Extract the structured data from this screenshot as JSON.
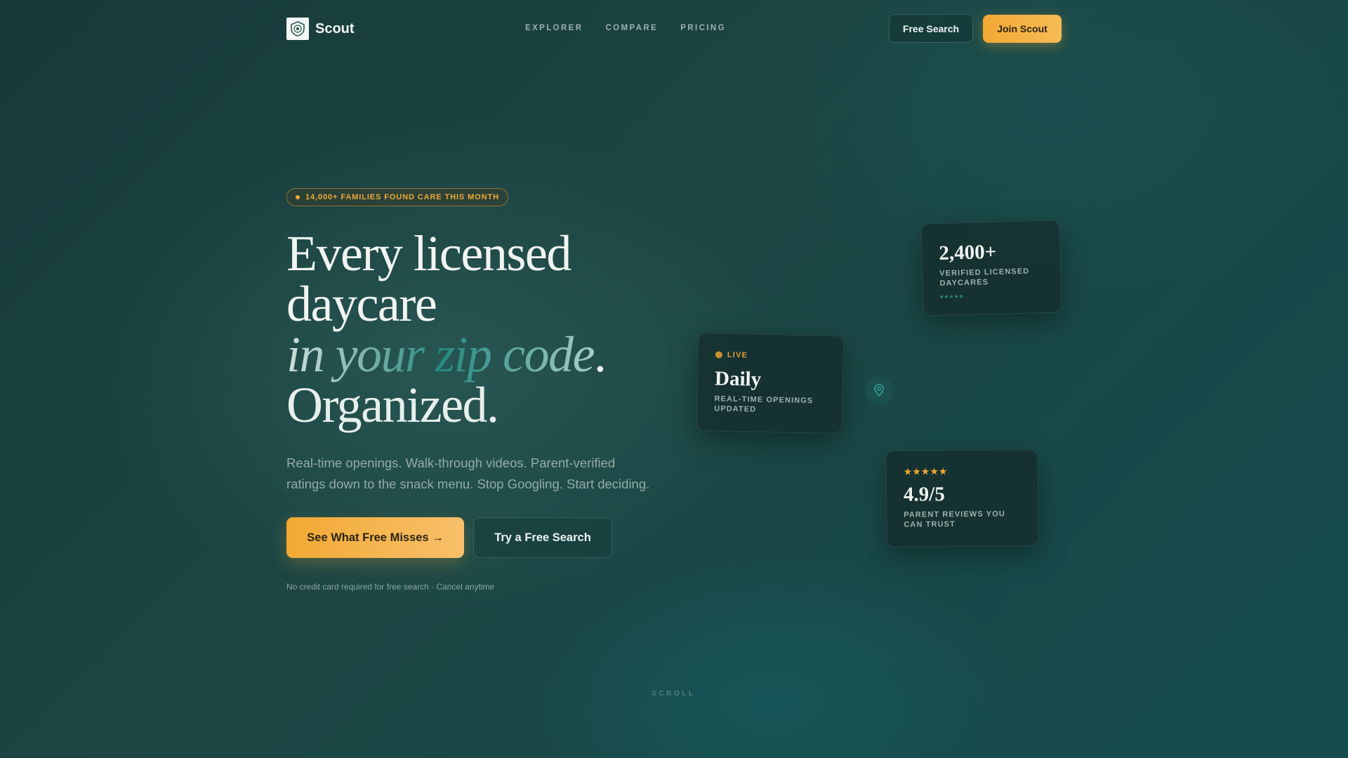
{
  "nav": {
    "brand": "Scout",
    "links": [
      "EXPLORER",
      "COMPARE",
      "PRICING"
    ],
    "free_search_label": "Free Search",
    "join_label": "Join Scout"
  },
  "hero": {
    "badge": "14,000+ FAMILIES FOUND CARE THIS MONTH",
    "title_line1": "Every licensed",
    "title_line2": "daycare",
    "title_accent": "in your zip code",
    "title_accent_end": ".",
    "title_line4": "Organized.",
    "subtitle": "Real-time openings. Walk-through videos. Parent-verified ratings down to the snack menu. Stop Googling. Start deciding.",
    "primary_cta": "See What Free Misses →",
    "secondary_cta": "Try a Free Search",
    "fineprint": "No credit card required for free search · Cancel anytime"
  },
  "cards": {
    "stat": {
      "number": "2,400+",
      "label": "VERIFIED LICENSED DAYCARES"
    },
    "live": {
      "status": "LIVE",
      "title": "Daily",
      "label": "REAL-TIME OPENINGS UPDATED"
    },
    "rating": {
      "stars": "★★★★★",
      "score": "4.9/5",
      "label": "PARENT REVIEWS YOU CAN TRUST"
    }
  },
  "scroll_label": "SCROLL",
  "icons": {
    "logo": "shield-logo-icon",
    "pin": "map-pin-icon",
    "live_dot": "live-dot-icon"
  },
  "colors": {
    "accent": "#f2a934",
    "teal": "#23897f",
    "background": "#1c4644"
  }
}
